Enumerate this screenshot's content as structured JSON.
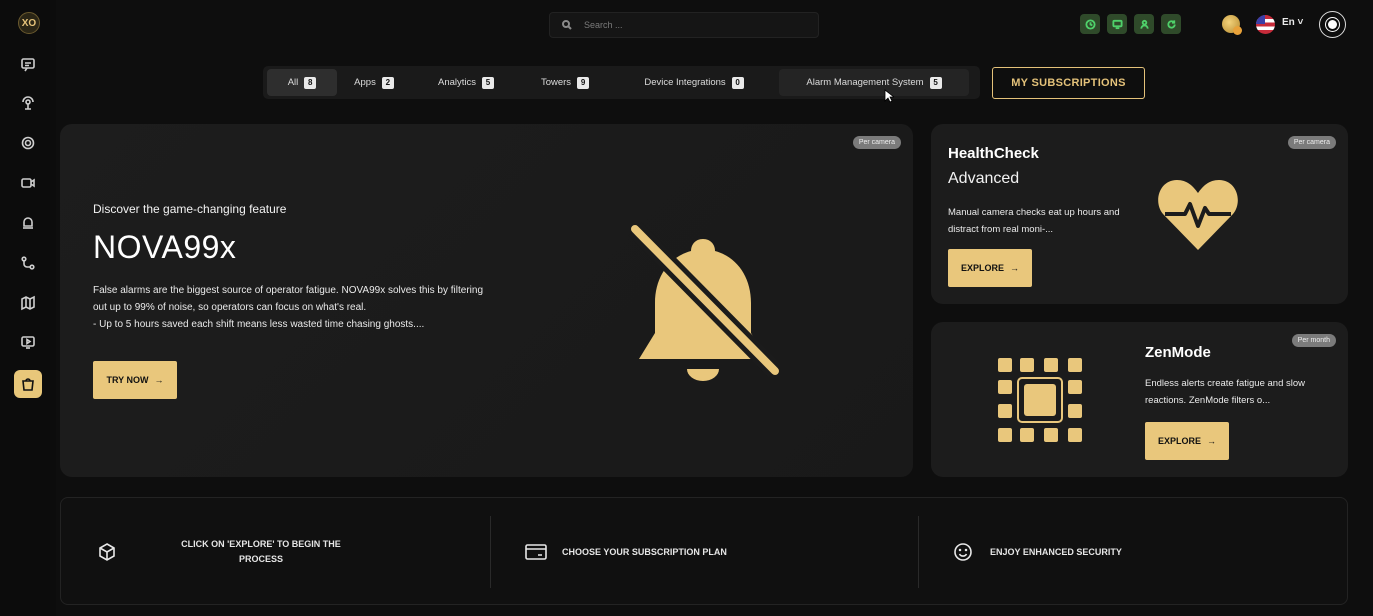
{
  "search": {
    "placeholder": "Search ..."
  },
  "header": {
    "language": "En"
  },
  "tabs": [
    {
      "label": "All",
      "count": "8"
    },
    {
      "label": "Apps",
      "count": "2"
    },
    {
      "label": "Analytics",
      "count": "5"
    },
    {
      "label": "Towers",
      "count": "9"
    },
    {
      "label": "Device Integrations",
      "count": "0"
    },
    {
      "label": "Alarm Management System",
      "count": "5"
    }
  ],
  "my_subscriptions": "MY SUBSCRIPTIONS",
  "hero": {
    "badge": "Per camera",
    "kicker": "Discover the game-changing feature",
    "title": "NOVA99x",
    "desc_1": "False alarms are the biggest source of operator fatigue. NOVA99x solves this by filtering out up to 99% of noise, so operators can focus on what's real.",
    "desc_2": "- Up to 5 hours saved each shift means less wasted time chasing ghosts....",
    "button": "TRY NOW"
  },
  "healthcheck": {
    "badge": "Per camera",
    "title": "HealthCheck",
    "subtitle": "Advanced",
    "desc": "Manual camera checks eat up hours and distract from real moni-...",
    "button": "EXPLORE"
  },
  "zenmode": {
    "badge": "Per month",
    "title": "ZenMode",
    "desc": "Endless alerts create fatigue and slow reactions. ZenMode filters o...",
    "button": "EXPLORE"
  },
  "steps": [
    {
      "label": "CLICK ON 'EXPLORE' TO BEGIN THE PROCESS"
    },
    {
      "label": "CHOOSE YOUR SUBSCRIPTION PLAN"
    },
    {
      "label": "ENJOY ENHANCED SECURITY"
    }
  ],
  "colors": {
    "accent": "#e9c77c",
    "background": "#0e0e0e",
    "card": "#1c1c1c"
  },
  "icons": {
    "sidebar": [
      "chat-icon",
      "radar-icon",
      "settings-icon",
      "camera-icon",
      "alarm-bell-icon",
      "routes-icon",
      "map-icon",
      "playback-icon",
      "shopping-bag-icon"
    ],
    "topbar": [
      "clock-icon",
      "monitor-icon",
      "user-icon",
      "refresh-icon",
      "coin-icon",
      "us-flag-icon",
      "theme-toggle-icon"
    ]
  }
}
